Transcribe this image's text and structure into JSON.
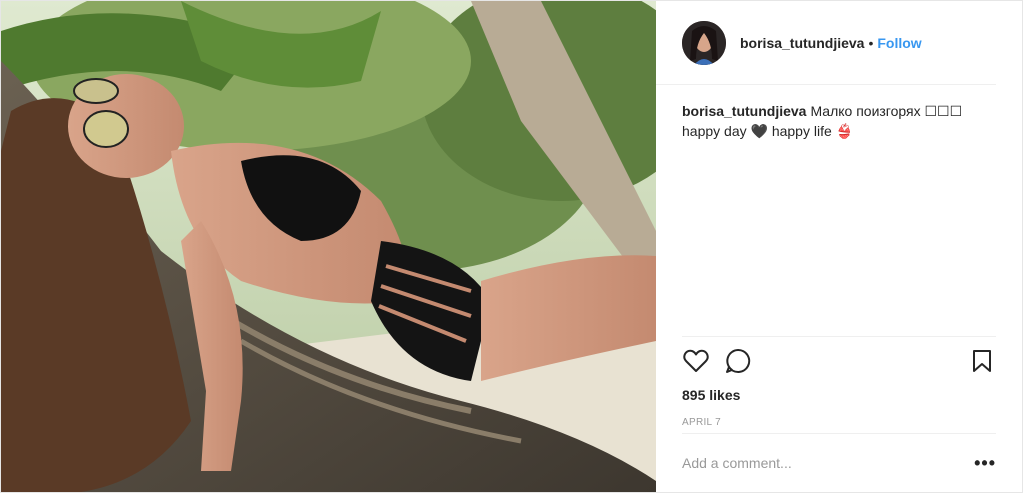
{
  "header": {
    "username": "borisa_tutundjieva",
    "separator": "•",
    "follow_label": "Follow"
  },
  "caption": {
    "username": "borisa_tutundjieva",
    "text": "Малко поизгорях ☐☐☐ happy day 🖤 happy life 👙"
  },
  "likes": "895 likes",
  "date": "APRIL 7",
  "comment": {
    "placeholder": "Add a comment..."
  },
  "more_label": "•••",
  "colors": {
    "link": "#3897f0",
    "muted": "#999999",
    "text": "#262626",
    "divider": "#efefef"
  },
  "icons": [
    "heart-icon",
    "comment-icon",
    "bookmark-icon",
    "more-options-icon"
  ]
}
